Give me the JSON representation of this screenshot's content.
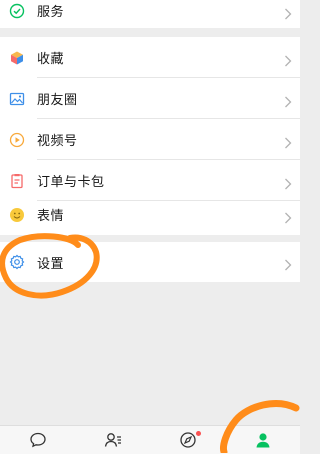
{
  "menu": {
    "top": {
      "label": "服务",
      "icon": "services-check-icon"
    },
    "group2": [
      {
        "label": "收藏",
        "icon": "favorites-cube-icon"
      },
      {
        "label": "朋友圈",
        "icon": "moments-image-icon"
      },
      {
        "label": "视频号",
        "icon": "channels-play-icon"
      },
      {
        "label": "订单与卡包",
        "icon": "orders-cards-icon"
      },
      {
        "label": "表情",
        "icon": "sticker-smile-icon"
      }
    ],
    "settings": {
      "label": "设置",
      "icon": "settings-gear-icon"
    }
  },
  "tabbar": {
    "tabs": [
      {
        "name": "chats",
        "icon": "chat-bubble-icon"
      },
      {
        "name": "contacts",
        "icon": "contacts-icon"
      },
      {
        "name": "discover",
        "icon": "compass-icon",
        "badge": true
      },
      {
        "name": "me",
        "icon": "profile-icon",
        "selected": true
      }
    ]
  },
  "colors": {
    "accent_green": "#07c160",
    "annotation_orange": "#ff8c1a",
    "badge_red": "#fa5151",
    "background": "#ededed"
  }
}
